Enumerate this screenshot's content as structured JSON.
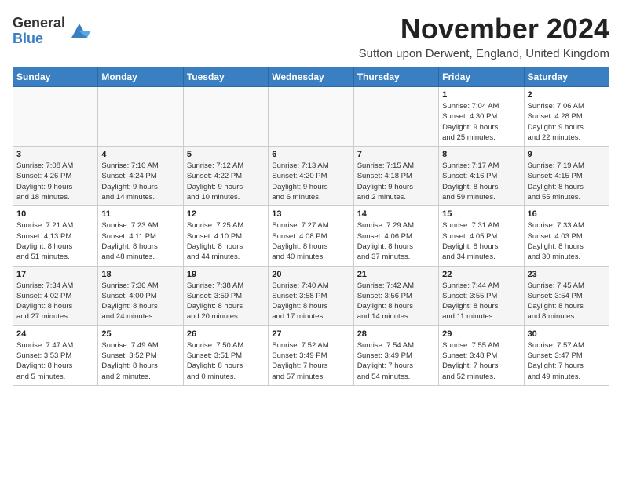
{
  "header": {
    "logo_general": "General",
    "logo_blue": "Blue",
    "title": "November 2024",
    "location": "Sutton upon Derwent, England, United Kingdom"
  },
  "weekdays": [
    "Sunday",
    "Monday",
    "Tuesday",
    "Wednesday",
    "Thursday",
    "Friday",
    "Saturday"
  ],
  "weeks": [
    [
      {
        "day": "",
        "info": ""
      },
      {
        "day": "",
        "info": ""
      },
      {
        "day": "",
        "info": ""
      },
      {
        "day": "",
        "info": ""
      },
      {
        "day": "",
        "info": ""
      },
      {
        "day": "1",
        "info": "Sunrise: 7:04 AM\nSunset: 4:30 PM\nDaylight: 9 hours\nand 25 minutes."
      },
      {
        "day": "2",
        "info": "Sunrise: 7:06 AM\nSunset: 4:28 PM\nDaylight: 9 hours\nand 22 minutes."
      }
    ],
    [
      {
        "day": "3",
        "info": "Sunrise: 7:08 AM\nSunset: 4:26 PM\nDaylight: 9 hours\nand 18 minutes."
      },
      {
        "day": "4",
        "info": "Sunrise: 7:10 AM\nSunset: 4:24 PM\nDaylight: 9 hours\nand 14 minutes."
      },
      {
        "day": "5",
        "info": "Sunrise: 7:12 AM\nSunset: 4:22 PM\nDaylight: 9 hours\nand 10 minutes."
      },
      {
        "day": "6",
        "info": "Sunrise: 7:13 AM\nSunset: 4:20 PM\nDaylight: 9 hours\nand 6 minutes."
      },
      {
        "day": "7",
        "info": "Sunrise: 7:15 AM\nSunset: 4:18 PM\nDaylight: 9 hours\nand 2 minutes."
      },
      {
        "day": "8",
        "info": "Sunrise: 7:17 AM\nSunset: 4:16 PM\nDaylight: 8 hours\nand 59 minutes."
      },
      {
        "day": "9",
        "info": "Sunrise: 7:19 AM\nSunset: 4:15 PM\nDaylight: 8 hours\nand 55 minutes."
      }
    ],
    [
      {
        "day": "10",
        "info": "Sunrise: 7:21 AM\nSunset: 4:13 PM\nDaylight: 8 hours\nand 51 minutes."
      },
      {
        "day": "11",
        "info": "Sunrise: 7:23 AM\nSunset: 4:11 PM\nDaylight: 8 hours\nand 48 minutes."
      },
      {
        "day": "12",
        "info": "Sunrise: 7:25 AM\nSunset: 4:10 PM\nDaylight: 8 hours\nand 44 minutes."
      },
      {
        "day": "13",
        "info": "Sunrise: 7:27 AM\nSunset: 4:08 PM\nDaylight: 8 hours\nand 40 minutes."
      },
      {
        "day": "14",
        "info": "Sunrise: 7:29 AM\nSunset: 4:06 PM\nDaylight: 8 hours\nand 37 minutes."
      },
      {
        "day": "15",
        "info": "Sunrise: 7:31 AM\nSunset: 4:05 PM\nDaylight: 8 hours\nand 34 minutes."
      },
      {
        "day": "16",
        "info": "Sunrise: 7:33 AM\nSunset: 4:03 PM\nDaylight: 8 hours\nand 30 minutes."
      }
    ],
    [
      {
        "day": "17",
        "info": "Sunrise: 7:34 AM\nSunset: 4:02 PM\nDaylight: 8 hours\nand 27 minutes."
      },
      {
        "day": "18",
        "info": "Sunrise: 7:36 AM\nSunset: 4:00 PM\nDaylight: 8 hours\nand 24 minutes."
      },
      {
        "day": "19",
        "info": "Sunrise: 7:38 AM\nSunset: 3:59 PM\nDaylight: 8 hours\nand 20 minutes."
      },
      {
        "day": "20",
        "info": "Sunrise: 7:40 AM\nSunset: 3:58 PM\nDaylight: 8 hours\nand 17 minutes."
      },
      {
        "day": "21",
        "info": "Sunrise: 7:42 AM\nSunset: 3:56 PM\nDaylight: 8 hours\nand 14 minutes."
      },
      {
        "day": "22",
        "info": "Sunrise: 7:44 AM\nSunset: 3:55 PM\nDaylight: 8 hours\nand 11 minutes."
      },
      {
        "day": "23",
        "info": "Sunrise: 7:45 AM\nSunset: 3:54 PM\nDaylight: 8 hours\nand 8 minutes."
      }
    ],
    [
      {
        "day": "24",
        "info": "Sunrise: 7:47 AM\nSunset: 3:53 PM\nDaylight: 8 hours\nand 5 minutes."
      },
      {
        "day": "25",
        "info": "Sunrise: 7:49 AM\nSunset: 3:52 PM\nDaylight: 8 hours\nand 2 minutes."
      },
      {
        "day": "26",
        "info": "Sunrise: 7:50 AM\nSunset: 3:51 PM\nDaylight: 8 hours\nand 0 minutes."
      },
      {
        "day": "27",
        "info": "Sunrise: 7:52 AM\nSunset: 3:49 PM\nDaylight: 7 hours\nand 57 minutes."
      },
      {
        "day": "28",
        "info": "Sunrise: 7:54 AM\nSunset: 3:49 PM\nDaylight: 7 hours\nand 54 minutes."
      },
      {
        "day": "29",
        "info": "Sunrise: 7:55 AM\nSunset: 3:48 PM\nDaylight: 7 hours\nand 52 minutes."
      },
      {
        "day": "30",
        "info": "Sunrise: 7:57 AM\nSunset: 3:47 PM\nDaylight: 7 hours\nand 49 minutes."
      }
    ]
  ]
}
